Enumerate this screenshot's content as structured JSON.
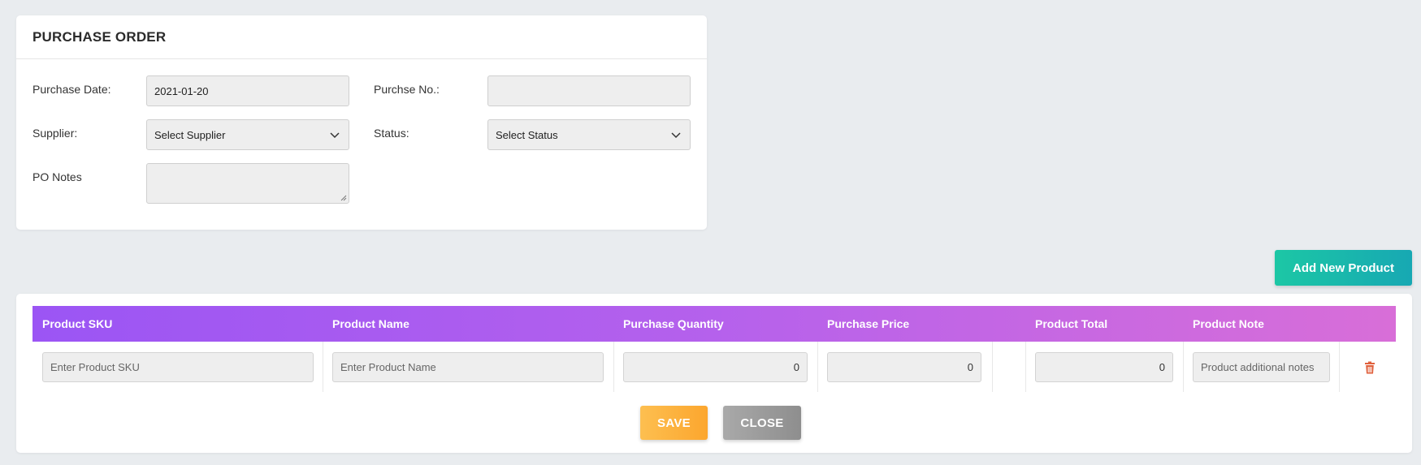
{
  "purchase_order": {
    "title": "PURCHASE ORDER",
    "purchase_date": {
      "label": "Purchase Date:",
      "value": "2021-01-20"
    },
    "purchase_no": {
      "label": "Purchse No.:",
      "value": ""
    },
    "supplier": {
      "label": "Supplier:",
      "selected": "Select Supplier"
    },
    "status": {
      "label": "Status:",
      "selected": "Select Status"
    },
    "po_notes": {
      "label": "PO Notes",
      "value": ""
    }
  },
  "add_product_button": "Add New Product",
  "table": {
    "headers": [
      "Product SKU",
      "Product Name",
      "Purchase Quantity",
      "Purchase Price",
      "Product Total",
      "Product Note"
    ],
    "row": {
      "sku_placeholder": "Enter Product SKU",
      "name_placeholder": "Enter Product Name",
      "quantity": "0",
      "price": "0",
      "total": "0",
      "note_placeholder": "Product additional notes"
    }
  },
  "actions": {
    "save": "SAVE",
    "close": "CLOSE"
  },
  "colors": {
    "header_gradient_start": "#9b55f4",
    "header_gradient_end": "#d86ed8",
    "add_button": "#1cc7a5",
    "save_button": "#fca62e",
    "close_button": "#999999",
    "delete_icon": "#e0603c"
  },
  "icons": {
    "select_caret": "chevron-down-icon",
    "delete": "trash-icon"
  }
}
